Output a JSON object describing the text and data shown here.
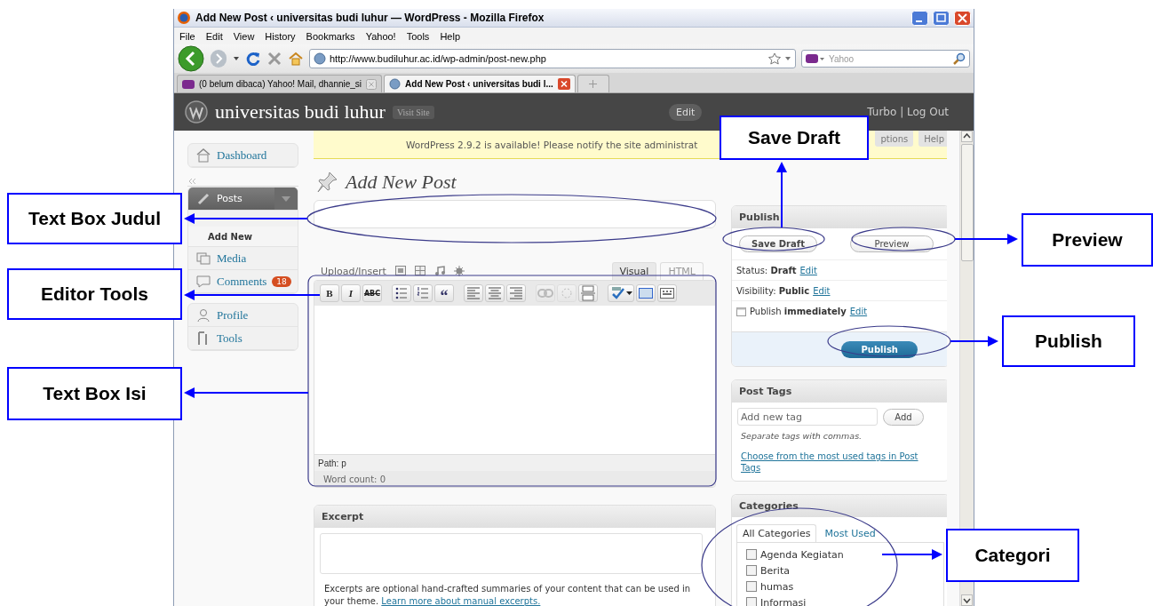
{
  "window": {
    "title": "Add New Post ‹ universitas budi luhur — WordPress - Mozilla Firefox"
  },
  "menu_bar": [
    "File",
    "Edit",
    "View",
    "History",
    "Bookmarks",
    "Yahoo!",
    "Tools",
    "Help"
  ],
  "address_bar": {
    "url": "http://www.budiluhur.ac.id/wp-admin/post-new.php"
  },
  "search": {
    "placeholder": "Yahoo"
  },
  "tabs": [
    {
      "label": "(0 belum dibaca) Yahoo! Mail, dhannie_si",
      "selected": false
    },
    {
      "label": "Add New Post ‹ universitas budi l...",
      "selected": true
    }
  ],
  "admin_header": {
    "site_name": "universitas budi luhur",
    "visit_site": "Visit Site",
    "edit_button": "Edit",
    "user_links": "Turbo | Log Out"
  },
  "notice": "WordPress 2.9.2 is available! Please notify the site administrat",
  "screen_options": "ptions",
  "help": "Help",
  "sidebar": {
    "items": [
      {
        "label": "Dashboard",
        "expanded": false
      },
      {
        "label": "Posts",
        "expanded": true,
        "children": [
          {
            "label": "Add New",
            "selected": true
          }
        ]
      },
      {
        "label": "Media",
        "expanded": false
      },
      {
        "label": "Comments",
        "expanded": false,
        "badge": "18"
      },
      {
        "label": "Profile",
        "expanded": false
      },
      {
        "label": "Tools",
        "expanded": false
      }
    ]
  },
  "page_title": "Add New Post",
  "editor": {
    "upload_insert": "Upload/Insert",
    "tabs": [
      {
        "label": "Visual",
        "selected": true
      },
      {
        "label": "HTML",
        "selected": false
      }
    ],
    "toolbar": [
      {
        "kind": "bold",
        "label": "B",
        "disabled": false
      },
      {
        "kind": "italic",
        "label": "I",
        "disabled": false
      },
      {
        "kind": "strike",
        "label": "ABC",
        "disabled": false
      },
      {
        "kind": "bullets",
        "disabled": false
      },
      {
        "kind": "numbers",
        "disabled": false
      },
      {
        "kind": "quote",
        "label": "“",
        "disabled": false
      },
      {
        "kind": "align-left",
        "disabled": false
      },
      {
        "kind": "align-center",
        "disabled": false
      },
      {
        "kind": "align-right",
        "disabled": false
      },
      {
        "kind": "link",
        "disabled": true
      },
      {
        "kind": "unlink",
        "disabled": true
      },
      {
        "kind": "more",
        "disabled": false
      },
      {
        "kind": "spell",
        "disabled": false
      },
      {
        "kind": "fullscreen",
        "disabled": false
      },
      {
        "kind": "kitchen",
        "disabled": false
      }
    ],
    "path": "Path: p",
    "word_count": "Word count: 0"
  },
  "excerpt": {
    "title": "Excerpt",
    "help": "Excerpts are optional hand-crafted summaries of your content that can be used in your theme.",
    "link": "Learn more about manual excerpts."
  },
  "publish": {
    "title": "Publish",
    "save_draft": "Save Draft",
    "preview": "Preview",
    "rows": [
      {
        "kind": "status",
        "text": "Status: **Draft**",
        "link": "Edit"
      },
      {
        "kind": "visibility",
        "text": "Visibility: **Public**",
        "link": "Edit"
      },
      {
        "kind": "schedule",
        "text": "Publish **immediately**",
        "link": "Edit"
      }
    ],
    "button": "Publish"
  },
  "post_tags": {
    "title": "Post Tags",
    "placeholder": "Add new tag",
    "add_button": "Add",
    "hint": "Separate tags with commas.",
    "link": "Choose from the most used tags in Post Tags"
  },
  "categories": {
    "title": "Categories",
    "tabs": [
      {
        "label": "All Categories",
        "selected": true
      },
      {
        "label": "Most Used",
        "selected": false
      }
    ],
    "items": [
      {
        "label": "Agenda Kegiatan",
        "checked": false
      },
      {
        "label": "Berita",
        "checked": false
      },
      {
        "label": "humas",
        "checked": false
      },
      {
        "label": "Informasi",
        "checked": false
      }
    ]
  },
  "annotations": [
    {
      "kind": "title",
      "label": "Text Box Judul"
    },
    {
      "kind": "tools",
      "label": "Editor Tools"
    },
    {
      "kind": "content",
      "label": "Text Box Isi"
    },
    {
      "kind": "save_draft",
      "label": "Save Draft"
    },
    {
      "kind": "preview",
      "label": "Preview"
    },
    {
      "kind": "publish",
      "label": "Publish"
    },
    {
      "kind": "categories",
      "label": "Categori"
    }
  ]
}
